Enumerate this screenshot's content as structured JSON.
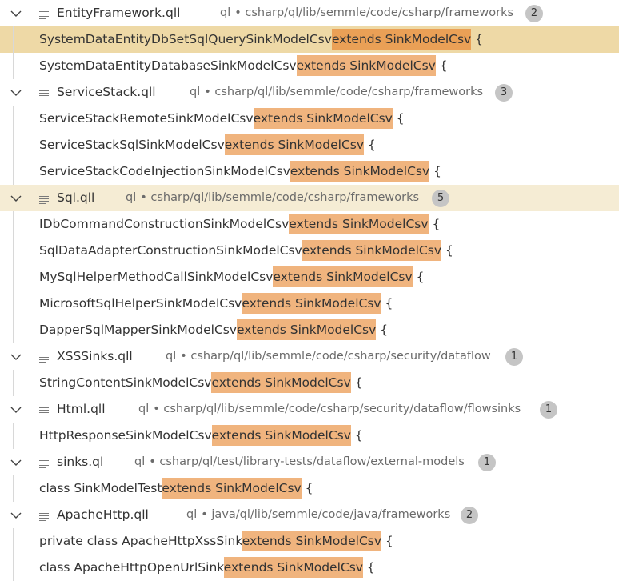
{
  "results": [
    {
      "file": "EntityFramework.qll",
      "source": "ql",
      "path": "csharp/ql/lib/semmle/code/csharp/frameworks",
      "count": "2",
      "matches": [
        {
          "before": "SystemDataEntityDbSetSqlQuerySinkModelCsv",
          "match": "extends SinkModelCsv",
          "after": " {"
        },
        {
          "before": "SystemDataEntityDatabaseSinkModelCsv",
          "match": "extends SinkModelCsv",
          "after": " {"
        }
      ]
    },
    {
      "file": "ServiceStack.qll",
      "source": "ql",
      "path": "csharp/ql/lib/semmle/code/csharp/frameworks",
      "count": "3",
      "matches": [
        {
          "before": "ServiceStackRemoteSinkModelCsv",
          "match": "extends SinkModelCsv",
          "after": " {"
        },
        {
          "before": "ServiceStackSqlSinkModelCsv",
          "match": "extends SinkModelCsv",
          "after": " {"
        },
        {
          "before": "ServiceStackCodeInjectionSinkModelCsv",
          "match": "extends SinkModelCsv",
          "after": " {"
        }
      ]
    },
    {
      "file": "Sql.qll",
      "source": "ql",
      "path": "csharp/ql/lib/semmle/code/csharp/frameworks",
      "count": "5",
      "matches": [
        {
          "before": "IDbCommandConstructionSinkModelCsv",
          "match": "extends SinkModelCsv",
          "after": " {"
        },
        {
          "before": "SqlDataAdapterConstructionSinkModelCsv",
          "match": "extends SinkModelCsv",
          "after": " {"
        },
        {
          "before": "MySqlHelperMethodCallSinkModelCsv",
          "match": "extends SinkModelCsv",
          "after": " {"
        },
        {
          "before": "MicrosoftSqlHelperSinkModelCsv",
          "match": "extends SinkModelCsv",
          "after": " {"
        },
        {
          "before": "DapperSqlMapperSinkModelCsv",
          "match": "extends SinkModelCsv",
          "after": " {"
        }
      ]
    },
    {
      "file": "XSSSinks.qll",
      "source": "ql",
      "path": "csharp/ql/lib/semmle/code/csharp/security/dataflow",
      "count": "1",
      "matches": [
        {
          "before": "StringContentSinkModelCsv",
          "match": "extends SinkModelCsv",
          "after": " {"
        }
      ]
    },
    {
      "file": "Html.qll",
      "source": "ql",
      "path": "csharp/ql/lib/semmle/code/csharp/security/dataflow/flowsinks",
      "count": "1",
      "matches": [
        {
          "before": "HttpResponseSinkModelCsv",
          "match": "extends SinkModelCsv",
          "after": " {"
        }
      ]
    },
    {
      "file": "sinks.ql",
      "source": "ql",
      "path": "csharp/ql/test/library-tests/dataflow/external-models",
      "count": "1",
      "matches": [
        {
          "before": "class SinkModelTest",
          "match": "extends SinkModelCsv",
          "after": " {"
        }
      ]
    },
    {
      "file": "ApacheHttp.qll",
      "source": "ql",
      "path": "java/ql/lib/semmle/code/java/frameworks",
      "count": "2",
      "matches": [
        {
          "before": "private class ApacheHttpXssSink",
          "match": "extends SinkModelCsv",
          "after": " {"
        },
        {
          "before": "class ApacheHttpOpenUrlSink",
          "match": "extends SinkModelCsv",
          "after": " {"
        }
      ]
    }
  ],
  "selected_match": "0.0",
  "focused_file": "2",
  "colors": {
    "highlight": "#f0b47e",
    "selected_row": "#eed9a6",
    "focused_row": "#f5ecd4",
    "badge": "#c5c5c5"
  },
  "icons": {
    "expand": "chevron-down-icon",
    "file": "file-lines-icon"
  }
}
